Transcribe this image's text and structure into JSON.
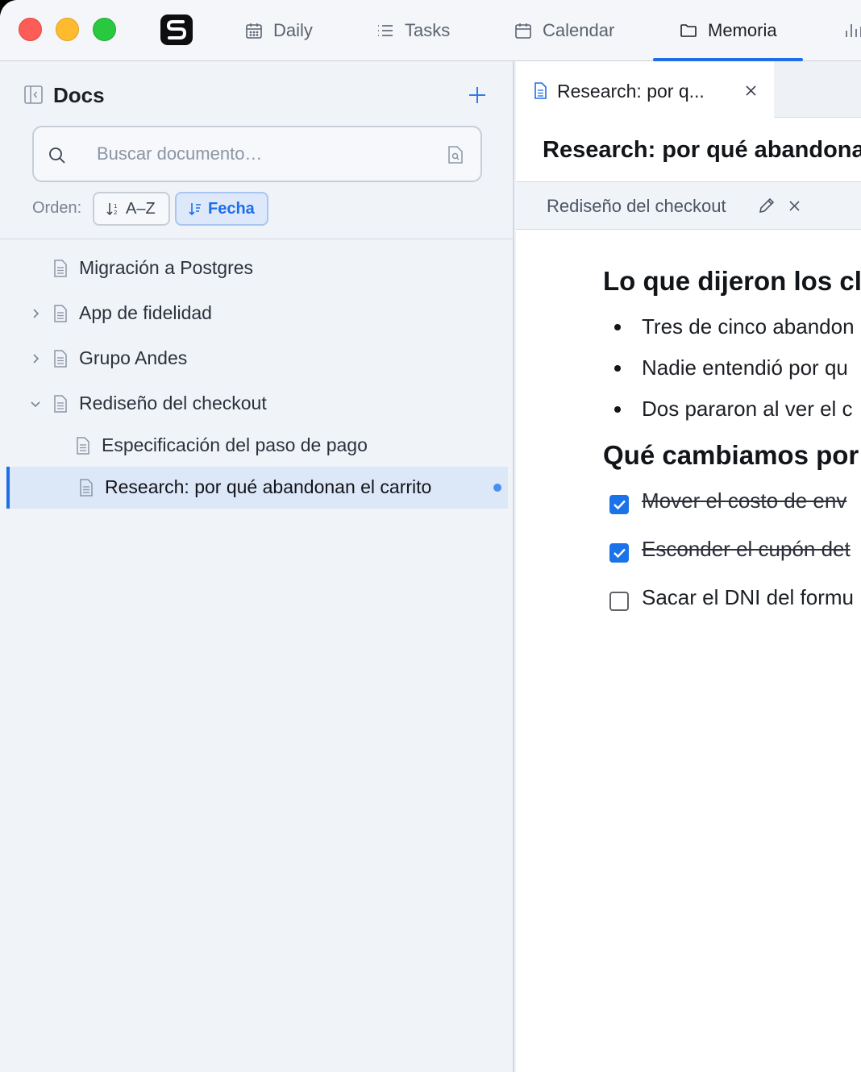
{
  "nav": {
    "tabs": [
      {
        "label": "Daily",
        "icon": "calendar-grid-icon"
      },
      {
        "label": "Tasks",
        "icon": "list-icon"
      },
      {
        "label": "Calendar",
        "icon": "calendar-icon"
      },
      {
        "label": "Memoria",
        "icon": "folder-icon",
        "active": true
      }
    ]
  },
  "sidebar": {
    "title": "Docs",
    "search": {
      "placeholder": "Buscar documento…",
      "value": ""
    },
    "order_label": "Orden:",
    "sort": {
      "az_label": "A–Z",
      "date_label": "Fecha",
      "active": "Fecha"
    },
    "items": [
      {
        "label": "Migración a Postgres",
        "level": 0,
        "expander": "none"
      },
      {
        "label": "App de fidelidad",
        "level": 0,
        "expander": "collapsed"
      },
      {
        "label": "Grupo Andes",
        "level": 0,
        "expander": "collapsed"
      },
      {
        "label": "Rediseño del checkout",
        "level": 0,
        "expander": "expanded"
      },
      {
        "label": "Especificación del paso de pago",
        "level": 1,
        "expander": "none"
      },
      {
        "label": "Research: por qué abandonan el carrito",
        "level": 1,
        "expander": "none",
        "selected": true,
        "unsaved": true
      }
    ]
  },
  "editor": {
    "tab_label": "Research: por q...",
    "doc_title": "Research: por qué abandonan el carrito",
    "parent": "Rediseño del checkout",
    "section1_heading": "Lo que dijeron los cl",
    "bullets": [
      "Tres de cinco abandon",
      "Nadie entendió por qu",
      "Dos pararon al ver el c"
    ],
    "section2_heading": "Qué cambiamos por",
    "checklist": [
      {
        "text": "Mover el costo de env",
        "checked": true
      },
      {
        "text": "Esconder el cupón det",
        "checked": true
      },
      {
        "text": "Sacar el DNI del formu",
        "checked": false
      }
    ]
  },
  "colors": {
    "accent": "#1e6ee8",
    "selected_row": "#dce7f8",
    "checkbox": "#1a73e8"
  }
}
